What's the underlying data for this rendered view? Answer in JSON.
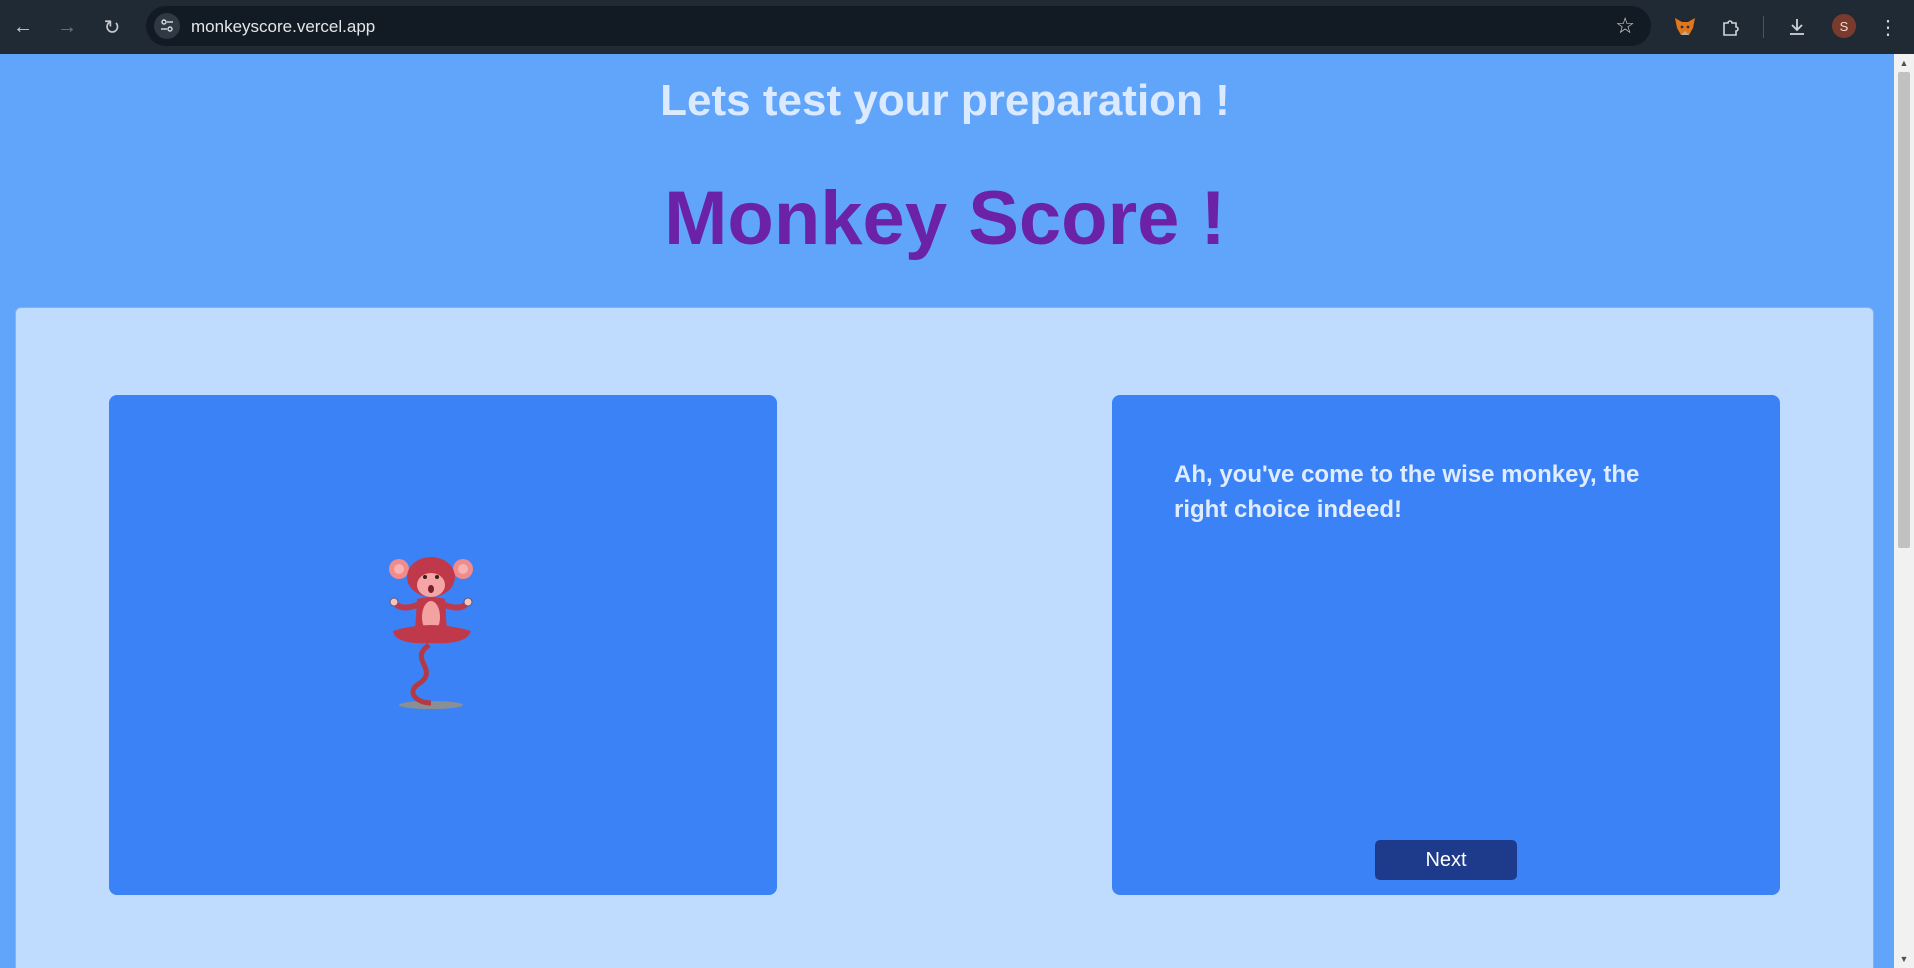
{
  "browser": {
    "url": "monkeyscore.vercel.app",
    "avatar_letter": "S",
    "icons": {
      "back": "back-arrow-icon",
      "forward": "forward-arrow-icon",
      "reload": "reload-icon",
      "site_info": "tune-icon",
      "bookmark": "star-icon",
      "extension_fox": "fox-extension-icon",
      "extensions": "puzzle-icon",
      "downloads": "download-icon",
      "menu": "kebab-menu-icon"
    }
  },
  "page": {
    "subtitle": "Lets test your preparation !",
    "title": "Monkey Score !",
    "dialog": {
      "text": "Ah, you've come to the wise monkey, the right choice indeed!",
      "next_label": "Next"
    }
  },
  "colors": {
    "page_background": "#60a5fa",
    "panel_background": "#bfdbfe",
    "card_background": "#3b82f6",
    "title_color": "#6b21a8",
    "subtitle_color": "#dbeafe",
    "button_background": "#1e3a8a"
  }
}
